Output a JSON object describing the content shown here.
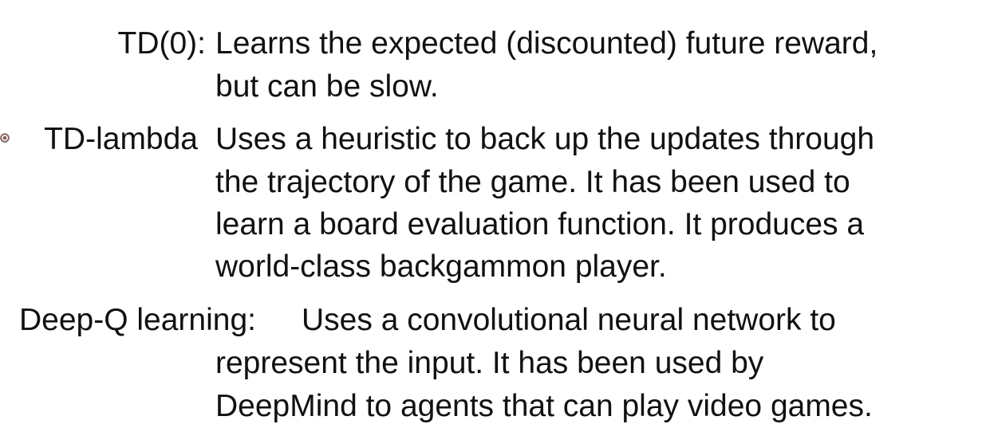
{
  "entries": [
    {
      "term": "TD(0):",
      "lines": [
        "Learns the expected (discounted) future reward,",
        "but can be slow."
      ]
    },
    {
      "term": "TD-lambda",
      "lines": [
        "Uses a heuristic to back up the updates through",
        "the trajectory of the game. It has been used to",
        "learn a board evaluation function. It produces a",
        "world-class backgammon player."
      ]
    },
    {
      "term": "Deep-Q learning:",
      "lines": [
        "Uses a convolutional neural network to",
        "represent the input. It has been used by",
        "DeepMind to agents that can play video games."
      ]
    }
  ],
  "icons": {
    "cursor": "cursor-icon"
  }
}
